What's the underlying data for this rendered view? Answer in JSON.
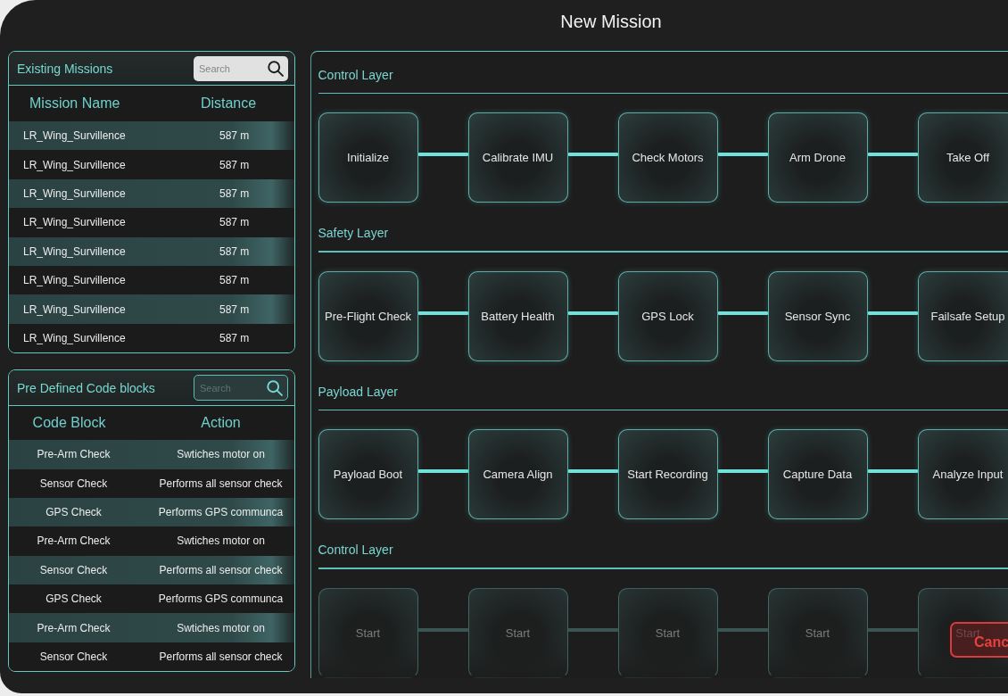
{
  "window": {
    "title": "New Mission"
  },
  "existing_missions": {
    "title": "Existing Missions",
    "search": {
      "placeholder": "Search"
    },
    "columns": [
      "Mission Name",
      "Distance"
    ],
    "rows": [
      [
        "LR_Wing_Survillence",
        "587 m"
      ],
      [
        "LR_Wing_Survillence",
        "587 m"
      ],
      [
        "LR_Wing_Survillence",
        "587 m"
      ],
      [
        "LR_Wing_Survillence",
        "587 m"
      ],
      [
        "LR_Wing_Survillence",
        "587 m"
      ],
      [
        "LR_Wing_Survillence",
        "587 m"
      ],
      [
        "LR_Wing_Survillence",
        "587 m"
      ],
      [
        "LR_Wing_Survillence",
        "587 m"
      ]
    ]
  },
  "code_blocks": {
    "title": "Pre Defined Code blocks",
    "search": {
      "placeholder": "Search"
    },
    "columns": [
      "Code Block",
      "Action"
    ],
    "rows": [
      [
        "Pre-Arm Check",
        "Swtiches motor on"
      ],
      [
        "Sensor Check",
        "Performs all sensor check"
      ],
      [
        "GPS Check",
        "Performs GPS communca"
      ],
      [
        "Pre-Arm Check",
        "Swtiches motor on"
      ],
      [
        "Sensor Check",
        "Performs all sensor check"
      ],
      [
        "GPS Check",
        "Performs GPS communca"
      ],
      [
        "Pre-Arm Check",
        "Swtiches motor on"
      ],
      [
        "Sensor Check",
        "Performs all sensor check"
      ]
    ]
  },
  "flow": {
    "layers": [
      {
        "title": "Control Layer",
        "nodes": [
          {
            "label": "Initialize",
            "disabled": false
          },
          {
            "label": "Calibrate IMU",
            "disabled": false
          },
          {
            "label": "Check Motors",
            "disabled": false
          },
          {
            "label": "Arm Drone",
            "disabled": false
          },
          {
            "label": "Take Off",
            "disabled": false
          }
        ]
      },
      {
        "title": "Safety Layer",
        "nodes": [
          {
            "label": "Pre-Flight Check",
            "disabled": false
          },
          {
            "label": "Battery Health",
            "disabled": false
          },
          {
            "label": "GPS Lock",
            "disabled": false
          },
          {
            "label": "Sensor Sync",
            "disabled": false
          },
          {
            "label": "Failsafe Setup",
            "disabled": false
          }
        ]
      },
      {
        "title": "Payload Layer",
        "nodes": [
          {
            "label": "Payload Boot",
            "disabled": false
          },
          {
            "label": "Camera Align",
            "disabled": false
          },
          {
            "label": "Start Recording",
            "disabled": false
          },
          {
            "label": "Capture Data",
            "disabled": false
          },
          {
            "label": "Analyze Input",
            "disabled": false
          }
        ]
      },
      {
        "title": "Control Layer",
        "nodes": [
          {
            "label": "Start",
            "disabled": true
          },
          {
            "label": "Start",
            "disabled": true
          },
          {
            "label": "Start",
            "disabled": true
          },
          {
            "label": "Start",
            "disabled": true
          },
          {
            "label": "Start",
            "disabled": true
          }
        ]
      }
    ]
  },
  "cancel_button": {
    "label": "Canc"
  }
}
